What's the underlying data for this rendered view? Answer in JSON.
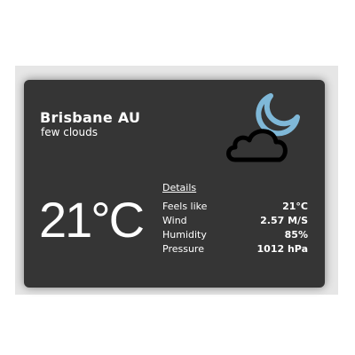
{
  "location": "Brisbane AU",
  "description": "few clouds",
  "icon": "moon-cloud-icon",
  "temperature": "21°C",
  "details": {
    "title": "Details",
    "rows": [
      {
        "label": "Feels like",
        "value": "21°C"
      },
      {
        "label": "Wind",
        "value": "2.57 M/S"
      },
      {
        "label": "Humidity",
        "value": "85%"
      },
      {
        "label": "Pressure",
        "value": "1012 hPa"
      }
    ]
  },
  "colors": {
    "card": "#353535",
    "moon": "#7fb8d8",
    "text": "#ffffff"
  }
}
